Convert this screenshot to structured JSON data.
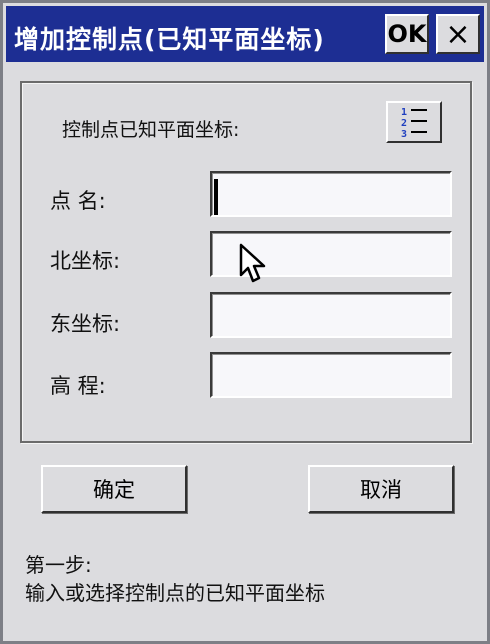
{
  "window": {
    "title": "增加控制点(已知平面坐标)",
    "ok_label": "OK",
    "close_symbol": "×"
  },
  "group": {
    "label": "控制点已知平面坐标:",
    "list_icon": "numbered-list-icon"
  },
  "fields": [
    {
      "label": "点  名:",
      "value": ""
    },
    {
      "label": "北坐标:",
      "value": ""
    },
    {
      "label": "东坐标:",
      "value": ""
    },
    {
      "label": "高  程:",
      "value": ""
    }
  ],
  "buttons": {
    "confirm": "确定",
    "cancel": "取消"
  },
  "instructions": {
    "step": "第一步:",
    "text": "输入或选择控制点的已知平面坐标"
  },
  "colors": {
    "titlebar": "#1d2e93",
    "window": "#dcdcdf",
    "input": "#f7f7fa"
  }
}
